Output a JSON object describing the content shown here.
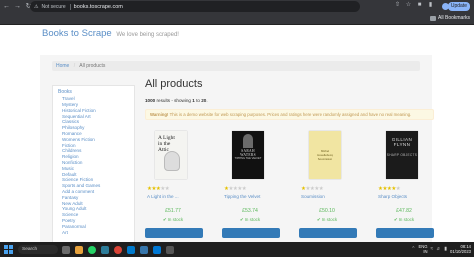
{
  "browser": {
    "not_secure": "Not secure",
    "url": "books.toscrape.com",
    "update_label": "Update",
    "all_bookmarks": "All Bookmarks"
  },
  "site": {
    "brand": "Books to Scrape",
    "tagline": "We love being scraped!"
  },
  "breadcrumb": {
    "home": "Home",
    "current": "All products"
  },
  "sidebar": {
    "root": "Books",
    "categories": [
      "Travel",
      "Mystery",
      "Historical Fiction",
      "Sequential Art",
      "Classics",
      "Philosophy",
      "Romance",
      "Womens Fiction",
      "Fiction",
      "Childrens",
      "Religion",
      "Nonfiction",
      "Music",
      "Default",
      "Science Fiction",
      "Sports and Games",
      "Add a comment",
      "Fantasy",
      "New Adult",
      "Young Adult",
      "Science",
      "Poetry",
      "Paranormal",
      "Art"
    ]
  },
  "main": {
    "heading": "All products",
    "results_count": "1000",
    "results_mid": " results - showing ",
    "results_from": "1",
    "results_to_word": " to ",
    "results_to": "20",
    "results_end": ".",
    "warning_label": "Warning!",
    "warning_text": " This is a demo website for web scraping purposes. Prices and ratings here were randomly assigned and have no real meaning."
  },
  "products": [
    {
      "title": "A Light in the ...",
      "price": "£51.77",
      "stock": "In stock",
      "rating": 3,
      "cover": {
        "line1": "A Light",
        "line2": "in the",
        "line3": "Attic"
      }
    },
    {
      "title": "Tipping the Velvet",
      "price": "£53.74",
      "stock": "In stock",
      "rating": 1,
      "cover": {
        "line1": "SARAH WATERS",
        "line2": "TIPPING THE VELVET"
      }
    },
    {
      "title": "Soumission",
      "price": "£50.10",
      "stock": "In stock",
      "rating": 1,
      "cover": {
        "line1": "Michel Houellebecq",
        "line2": "Soumission"
      }
    },
    {
      "title": "Sharp Objects",
      "price": "£47.82",
      "stock": "In stock",
      "rating": 4,
      "cover": {
        "line1": "GILLIAN FLYNN",
        "line2": "SHARP OBJECTS"
      }
    }
  ],
  "taskbar": {
    "search_placeholder": "Search",
    "language": "ENG",
    "region": "IN",
    "time": "08:14",
    "date": "01/10/2023"
  },
  "colors": {
    "link": "#5a8ec6",
    "price": "#5cb85c",
    "star": "#e5c100",
    "warning_bg": "#fcf8e3",
    "warning_text": "#c09853",
    "basket_button": "#337ab7"
  }
}
